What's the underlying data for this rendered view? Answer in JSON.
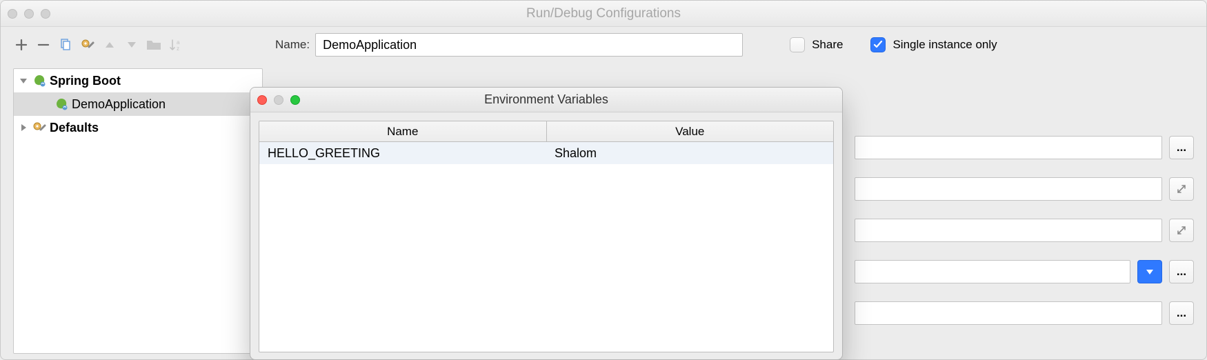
{
  "window": {
    "title": "Run/Debug Configurations"
  },
  "toolbar": {
    "name_label": "Name:",
    "name_value": "DemoApplication",
    "share_label": "Share",
    "share_checked": false,
    "single_label": "Single instance only",
    "single_checked": true
  },
  "tree": {
    "items": [
      {
        "label": "Spring Boot",
        "bold": true,
        "expanded": true,
        "icon": "spring-icon"
      },
      {
        "label": "DemoApplication",
        "bold": false,
        "selected": true,
        "icon": "spring-icon",
        "indent": 1
      },
      {
        "label": "Defaults",
        "bold": true,
        "expanded": false,
        "icon": "gear-wrench-icon"
      }
    ]
  },
  "env_dialog": {
    "title": "Environment Variables",
    "columns": {
      "name": "Name",
      "value": "Value"
    },
    "rows": [
      {
        "name": "HELLO_GREETING",
        "value": "Shalom"
      }
    ]
  },
  "aux": {
    "ellipsis": "...",
    "expand_tip": "expand",
    "dropdown_tip": "dropdown"
  },
  "colors": {
    "accent": "#2f79ff"
  }
}
